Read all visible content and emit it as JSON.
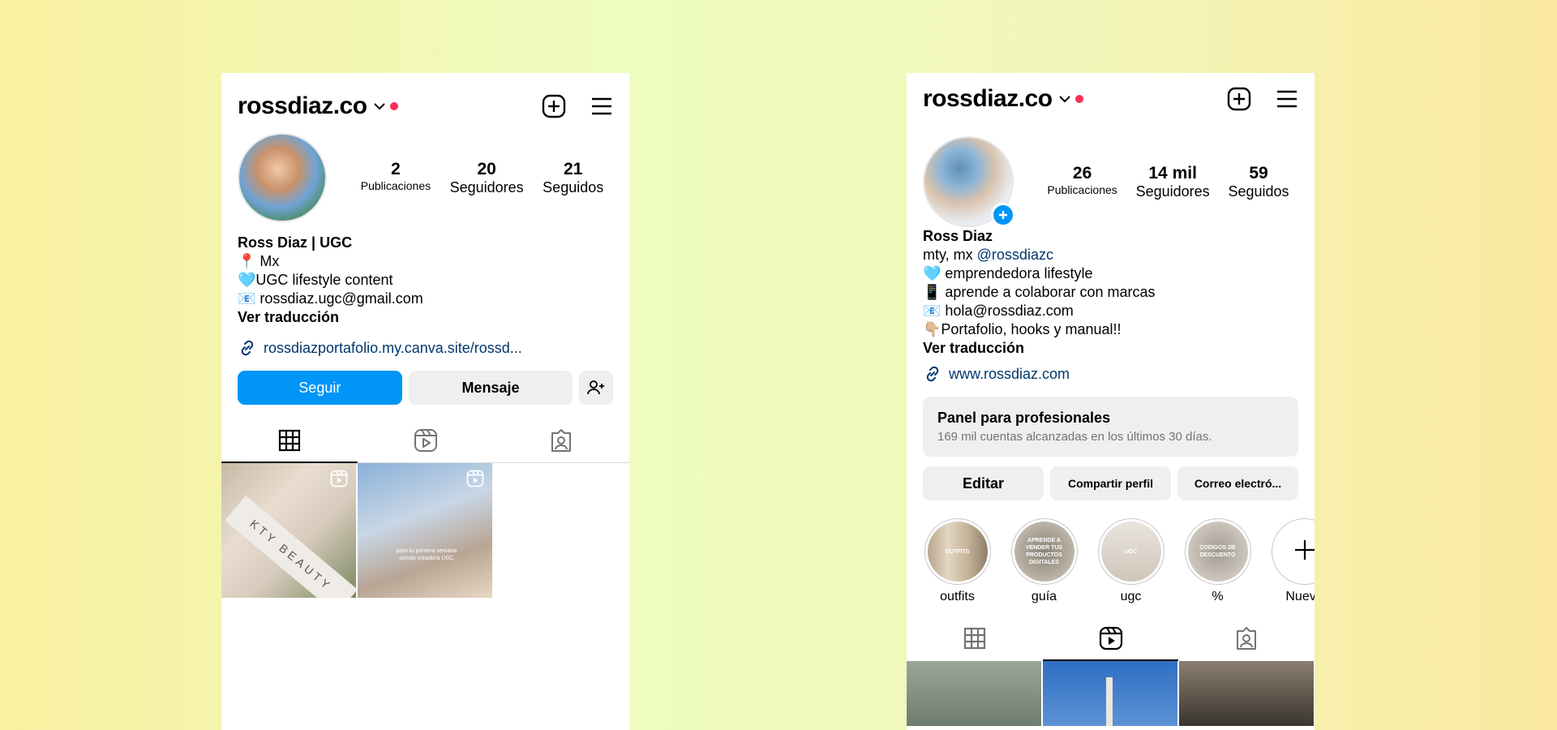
{
  "left": {
    "username": "rossdiaz.co",
    "stats": [
      {
        "num": "2",
        "label": "Publicaciones"
      },
      {
        "num": "20",
        "label": "Seguidores"
      },
      {
        "num": "21",
        "label": "Seguidos"
      }
    ],
    "bio": {
      "name": "Ross Diaz | UGC",
      "lines": [
        "📍 Mx",
        "🩵UGC lifestyle content",
        "📧 rossdiaz.ugc@gmail.com"
      ],
      "translate": "Ver traducción"
    },
    "link": "rossdiazportafolio.my.canva.site/rossd...",
    "buttons": {
      "follow": "Seguir",
      "message": "Mensaje"
    },
    "thumb_texts": [
      "KTY BEAUTY",
      "pero tu primera semana siendo creadora UGC"
    ]
  },
  "right": {
    "username": "rossdiaz.co",
    "stats": [
      {
        "num": "26",
        "label": "Publicaciones"
      },
      {
        "num": "14 mil",
        "label": "Seguidores"
      },
      {
        "num": "59",
        "label": "Seguidos"
      }
    ],
    "bio": {
      "name": "Ross Diaz",
      "location": "mty, mx ",
      "mention": "@rossdiazc",
      "lines": [
        "🩵 emprendedora lifestyle",
        "📱 aprende a colaborar con marcas",
        "📧 hola@rossdiaz.com",
        "👇🏼Portafolio, hooks y manual!!"
      ],
      "translate": "Ver traducción"
    },
    "link": "www.rossdiaz.com",
    "pro_panel": {
      "title": "Panel para profesionales",
      "subtitle": "169 mil cuentas alcanzadas en los últimos 30 días."
    },
    "buttons": {
      "edit": "Editar",
      "share": "Compartir perfil",
      "email": "Correo electró..."
    },
    "highlights": [
      {
        "label": "outfits",
        "inner": "OUTFITS"
      },
      {
        "label": "guía",
        "inner": "APRENDE A VENDER TUS PRODUCTOS DIGITALES"
      },
      {
        "label": "ugc",
        "inner": "UGC"
      },
      {
        "label": "%",
        "inner": "CODIGOS DE DESCUENTO"
      },
      {
        "label": "Nueva",
        "inner": ""
      }
    ]
  },
  "colors": {
    "primary": "#0095f6",
    "red_dot": "#ff2d55",
    "link": "#00376b"
  }
}
